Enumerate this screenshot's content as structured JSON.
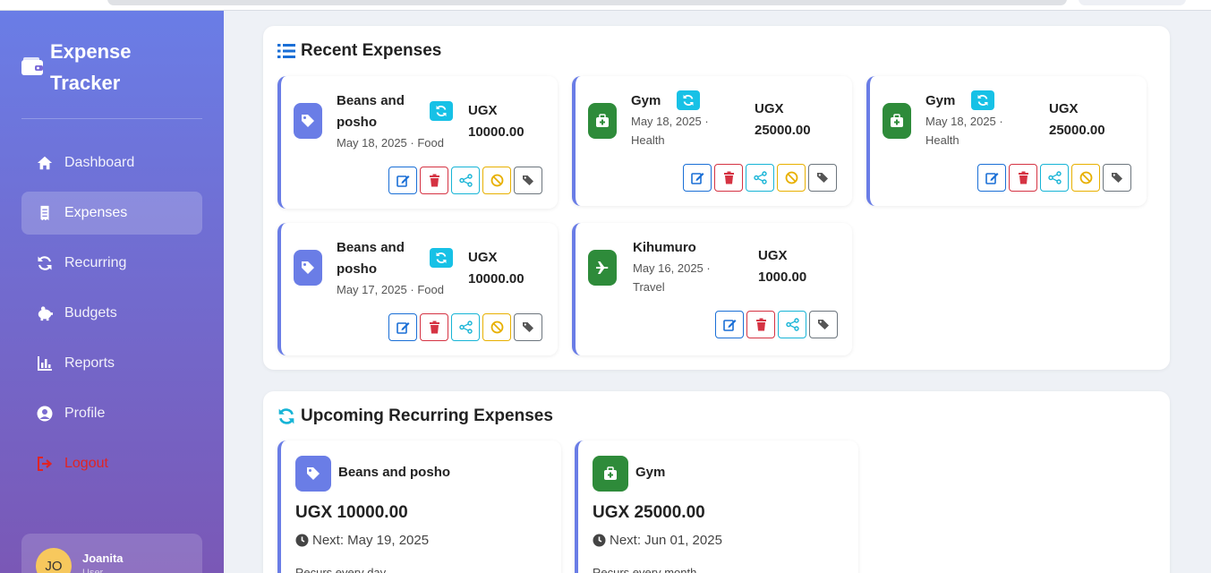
{
  "app": {
    "title": "Expense Tracker"
  },
  "colors": {
    "accent": "#6a7de6",
    "food": "#6a7de6",
    "health": "#2e8b3a",
    "travel": "#2e8b3a",
    "recurring_badge": "#17c1e6",
    "logout": "#e02424"
  },
  "sidebar": {
    "items": [
      {
        "label": "Dashboard",
        "icon": "home-icon"
      },
      {
        "label": "Expenses",
        "icon": "receipt-icon",
        "active": true
      },
      {
        "label": "Recurring",
        "icon": "sync-icon"
      },
      {
        "label": "Budgets",
        "icon": "piggy-bank-icon"
      },
      {
        "label": "Reports",
        "icon": "chart-icon"
      },
      {
        "label": "Profile",
        "icon": "user-circle-icon"
      },
      {
        "label": "Logout",
        "icon": "logout-icon"
      }
    ],
    "user": {
      "initials": "JO",
      "name": "Joanita",
      "role": "User"
    }
  },
  "recent": {
    "title": "Recent Expenses",
    "expenses": [
      {
        "name_line1": "Beans and",
        "name_line2": "posho",
        "meta_line1": "May 18, 2025 · Food",
        "currency": "UGX",
        "amount": "10000.00",
        "recurring": true,
        "icon": "tag-icon"
      },
      {
        "name_line1": "Gym",
        "meta_line1": "May 18, 2025 ·",
        "meta_line2": "Health",
        "currency": "UGX",
        "amount": "25000.00",
        "recurring": true,
        "icon": "medkit-icon"
      },
      {
        "name_line1": "Gym",
        "meta_line1": "May 18, 2025 ·",
        "meta_line2": "Health",
        "currency": "UGX",
        "amount": "25000.00",
        "recurring": true,
        "icon": "medkit-icon"
      },
      {
        "name_line1": "Beans and",
        "name_line2": "posho",
        "meta_line1": "May 17, 2025 · Food",
        "currency": "UGX",
        "amount": "10000.00",
        "recurring": true,
        "icon": "tag-icon"
      },
      {
        "name_line1": "Kihumuro",
        "meta_line1": "May 16, 2025 ·",
        "meta_line2": "Travel",
        "currency": "UGX",
        "amount": "1000.00",
        "recurring": false,
        "icon": "plane-icon"
      }
    ]
  },
  "upcoming": {
    "title": "Upcoming Recurring Expenses",
    "items": [
      {
        "name": "Beans and posho",
        "amount": "UGX 10000.00",
        "next": "Next: May 19, 2025",
        "desc": "Recurs every day ...",
        "icon": "tag-icon"
      },
      {
        "name": "Gym",
        "amount": "UGX 25000.00",
        "next": "Next: Jun 01, 2025",
        "desc": "Recurs every month ...",
        "icon": "medkit-icon"
      }
    ]
  }
}
